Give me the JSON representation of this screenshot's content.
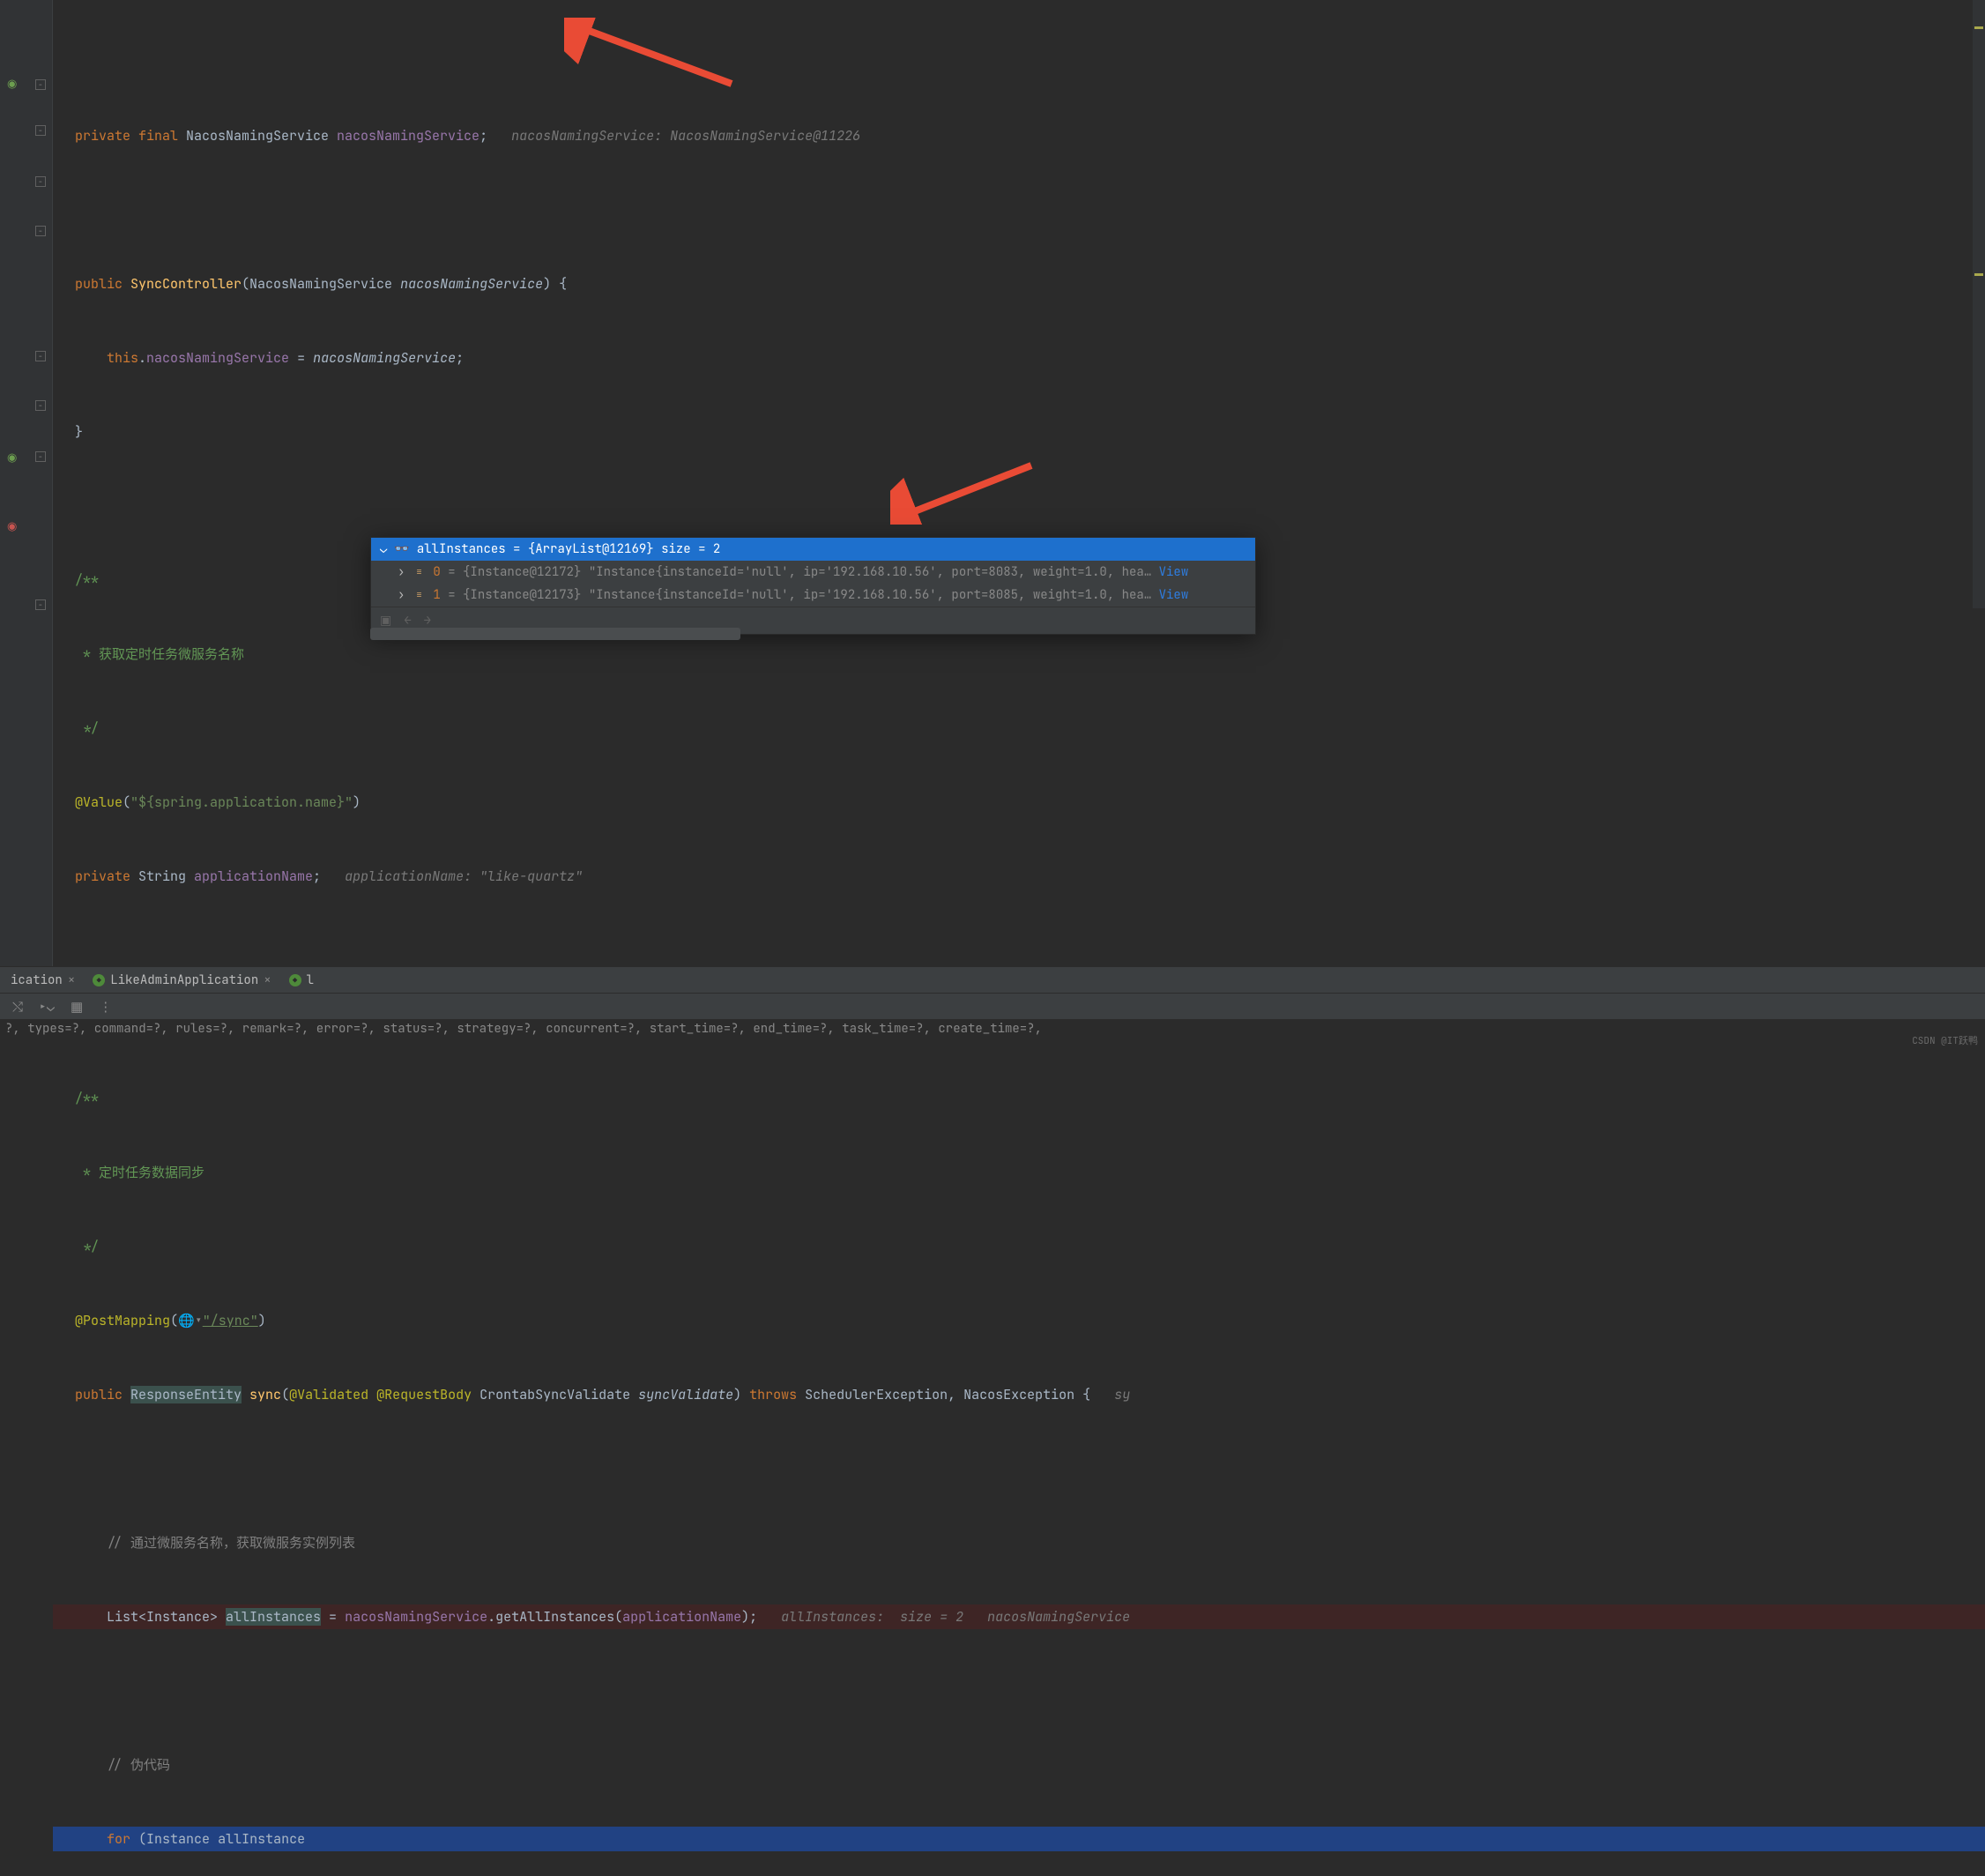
{
  "code": {
    "l1": {
      "kw1": "private ",
      "kw2": "final ",
      "type": "NacosNamingService ",
      "field": "nacosNamingService",
      "semi": ";",
      "hint": "   nacosNamingService: NacosNamingService@11226"
    },
    "l2": {
      "kw": "public ",
      "method": "SyncController",
      "open": "(",
      "type": "NacosNamingService ",
      "param": "nacosNamingService",
      "close": ") {",
      "hint": ""
    },
    "l3": {
      "kw": "this",
      "dot": ".",
      "field": "nacosNamingService",
      "eq": " = ",
      "param": "nacosNamingService",
      "semi": ";"
    },
    "l4": "}",
    "l5": "/**",
    "l6": " * 获取定时任务微服务名称",
    "l7": " */",
    "l8": {
      "anno": "@Value",
      "open": "(",
      "str": "\"${spring.application.name}\"",
      "close": ")"
    },
    "l9": {
      "kw": "private ",
      "type": "String ",
      "field": "applicationName",
      "semi": ";",
      "hint": "   applicationName: \"like-quartz\""
    },
    "l10": "/**",
    "l11": " * 定时任务数据同步",
    "l12": " */",
    "l13": {
      "anno": "@PostMapping",
      "open": "(",
      "globe": "🌐▾",
      "str": "\"/sync\"",
      "close": ")"
    },
    "l14": {
      "kw": "public ",
      "type": "ResponseEntity",
      "sp": " ",
      "method": "sync",
      "open": "(",
      "anno1": "@Validated ",
      "anno2": "@RequestBody ",
      "type2": "CrontabSyncValidate ",
      "param": "syncValidate",
      "close": ") ",
      "kw2": "throws ",
      "type3": "SchedulerException, NacosException {",
      "hint": "   sy"
    },
    "l15": "// 通过微服务名称，获取微服务实例列表",
    "l16": {
      "type": "List<Instance> ",
      "var": "allInstances",
      "eq": " = ",
      "field": "nacosNamingService",
      "dot": ".",
      "method": "getAllInstances",
      "open": "(",
      "field2": "applicationName",
      "close": ");",
      "hint": "   allInstances:  size = 2   nacosNamingService"
    },
    "l17": "// 伪代码",
    "l18": {
      "kw": "for ",
      "open": "(",
      "type": "Instance ",
      "var": "allInstance "
    }
  },
  "debug": {
    "header": {
      "var": "allInstances",
      "eq": " = ",
      "cls": "{ArrayList@12169}",
      "size": "  size = 2"
    },
    "rows": [
      {
        "idx": "0",
        "eq": " = ",
        "cls": "{Instance@12172}",
        "val": " \"Instance{instanceId='null', ip='192.168.10.56', port=8083, weight=1.0, hea…",
        "view": " View"
      },
      {
        "idx": "1",
        "eq": " = ",
        "cls": "{Instance@12173}",
        "val": " \"Instance{instanceId='null', ip='192.168.10.56', port=8085, weight=1.0, hea…",
        "view": " View"
      }
    ]
  },
  "tabs": {
    "t1": "ication",
    "t2": "LikeAdminApplication",
    "t3": "l"
  },
  "console": {
    "line1": "?, types=?, command=?, rules=?, remark=?, error=?, status=?, strategy=?, concurrent=?, start_time=?, end_time=?, task_time=?, create_time=?,"
  },
  "watermark": "CSDN @IT跃鸭"
}
